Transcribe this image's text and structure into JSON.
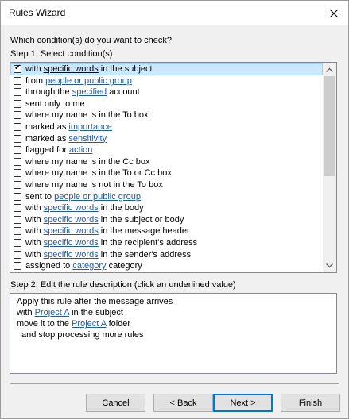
{
  "window": {
    "title": "Rules Wizard"
  },
  "prompt": "Which condition(s) do you want to check?",
  "step1_label": "Step 1: Select condition(s)",
  "conditions": [
    {
      "checked": true,
      "selected": true,
      "parts": [
        {
          "t": "with "
        },
        {
          "t": "specific words",
          "link": true
        },
        {
          "t": " in the subject"
        }
      ]
    },
    {
      "checked": false,
      "selected": false,
      "parts": [
        {
          "t": "from "
        },
        {
          "t": "people or public group",
          "link": true
        }
      ]
    },
    {
      "checked": false,
      "selected": false,
      "parts": [
        {
          "t": "through the "
        },
        {
          "t": "specified",
          "link": true
        },
        {
          "t": " account"
        }
      ]
    },
    {
      "checked": false,
      "selected": false,
      "parts": [
        {
          "t": "sent only to me"
        }
      ]
    },
    {
      "checked": false,
      "selected": false,
      "parts": [
        {
          "t": "where my name is in the To box"
        }
      ]
    },
    {
      "checked": false,
      "selected": false,
      "parts": [
        {
          "t": "marked as "
        },
        {
          "t": "importance",
          "link": true
        }
      ]
    },
    {
      "checked": false,
      "selected": false,
      "parts": [
        {
          "t": "marked as "
        },
        {
          "t": "sensitivity",
          "link": true
        }
      ]
    },
    {
      "checked": false,
      "selected": false,
      "parts": [
        {
          "t": "flagged for "
        },
        {
          "t": "action",
          "link": true
        }
      ]
    },
    {
      "checked": false,
      "selected": false,
      "parts": [
        {
          "t": "where my name is in the Cc box"
        }
      ]
    },
    {
      "checked": false,
      "selected": false,
      "parts": [
        {
          "t": "where my name is in the To or Cc box"
        }
      ]
    },
    {
      "checked": false,
      "selected": false,
      "parts": [
        {
          "t": "where my name is not in the To box"
        }
      ]
    },
    {
      "checked": false,
      "selected": false,
      "parts": [
        {
          "t": "sent to "
        },
        {
          "t": "people or public group",
          "link": true
        }
      ]
    },
    {
      "checked": false,
      "selected": false,
      "parts": [
        {
          "t": "with "
        },
        {
          "t": "specific words",
          "link": true
        },
        {
          "t": " in the body"
        }
      ]
    },
    {
      "checked": false,
      "selected": false,
      "parts": [
        {
          "t": "with "
        },
        {
          "t": "specific words",
          "link": true
        },
        {
          "t": " in the subject or body"
        }
      ]
    },
    {
      "checked": false,
      "selected": false,
      "parts": [
        {
          "t": "with "
        },
        {
          "t": "specific words",
          "link": true
        },
        {
          "t": " in the message header"
        }
      ]
    },
    {
      "checked": false,
      "selected": false,
      "parts": [
        {
          "t": "with "
        },
        {
          "t": "specific words",
          "link": true
        },
        {
          "t": " in the recipient's address"
        }
      ]
    },
    {
      "checked": false,
      "selected": false,
      "parts": [
        {
          "t": "with "
        },
        {
          "t": "specific words",
          "link": true
        },
        {
          "t": " in the sender's address"
        }
      ]
    },
    {
      "checked": false,
      "selected": false,
      "parts": [
        {
          "t": "assigned to "
        },
        {
          "t": "category",
          "link": true
        },
        {
          "t": " category"
        }
      ]
    }
  ],
  "step2_label": "Step 2: Edit the rule description (click an underlined value)",
  "description": {
    "line1": "Apply this rule after the message arrives",
    "line2_pre": "with ",
    "line2_link": "Project A",
    "line2_post": " in the subject",
    "line3_pre": "move it to the ",
    "line3_link": "Project A",
    "line3_post": " folder",
    "line4": "and stop processing more rules"
  },
  "buttons": {
    "cancel": "Cancel",
    "back": "< Back",
    "next": "Next >",
    "finish": "Finish"
  }
}
